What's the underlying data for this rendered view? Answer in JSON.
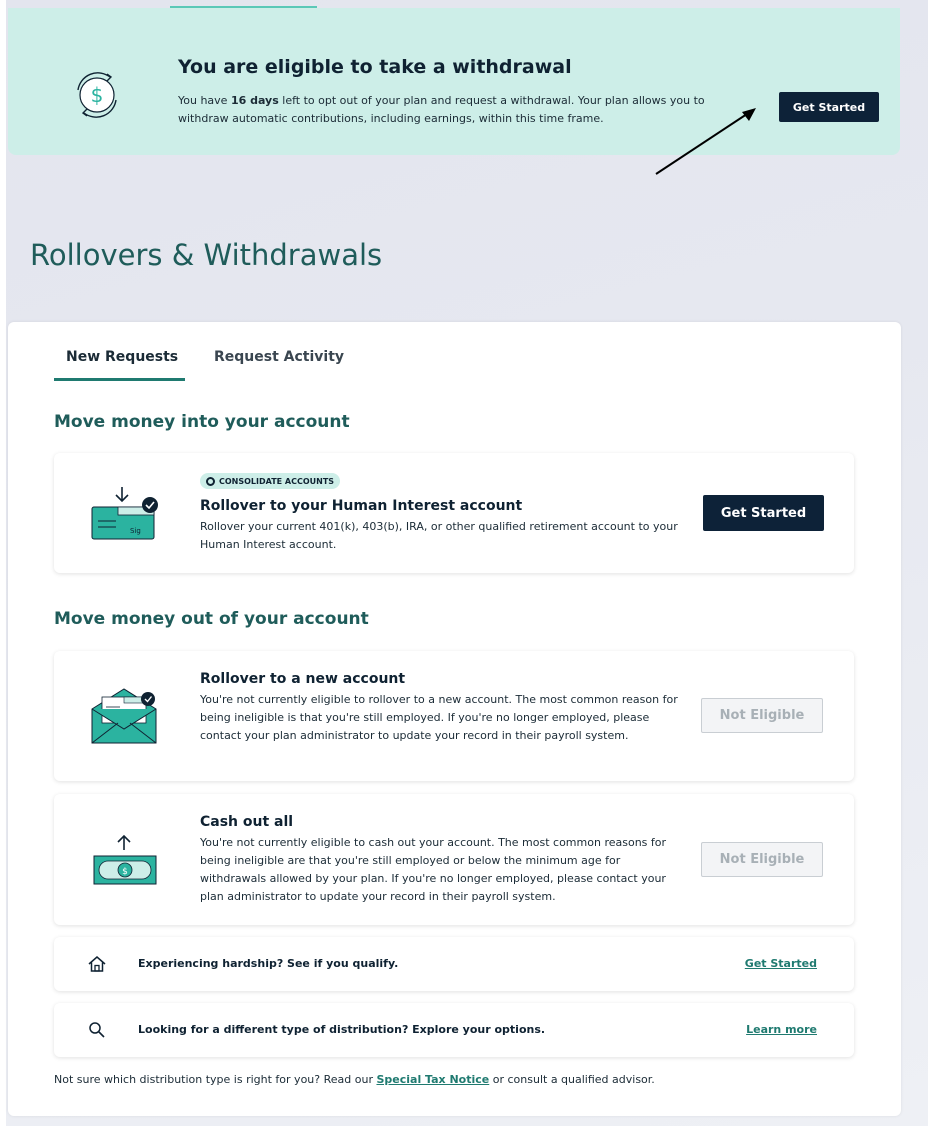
{
  "banner": {
    "title": "You are eligible to take a withdrawal",
    "text_before": "You have ",
    "days": "16 days",
    "text_after": " left to opt out of your plan and request a withdrawal. Your plan allows you to withdraw automatic contributions, including earnings, within this time frame.",
    "button": "Get Started"
  },
  "page_title": "Rollovers & Withdrawals",
  "tabs": [
    {
      "label": "New Requests",
      "active": true
    },
    {
      "label": "Request Activity",
      "active": false
    }
  ],
  "section_in": {
    "heading": "Move money into your account",
    "card": {
      "badge": "CONSOLIDATE ACCOUNTS",
      "title": "Rollover to your Human Interest account",
      "desc": "Rollover your current 401(k), 403(b), IRA, or other qualified retirement account to your Human Interest account.",
      "button": "Get Started"
    }
  },
  "section_out": {
    "heading": "Move money out of your account",
    "cards": [
      {
        "title": "Rollover to a new account",
        "desc": "You're not currently eligible to rollover to a new account. The most common reason for being ineligible is that you're still employed. If you're no longer employed, please contact your plan administrator to update your record in their payroll system.",
        "button": "Not Eligible"
      },
      {
        "title": "Cash out all",
        "desc": "You're not currently eligible to cash out your account. The most common reasons for being ineligible are that you're still employed or below the minimum age for withdrawals allowed by your plan. If you're no longer employed, please contact your plan administrator to update your record in their payroll system.",
        "button": "Not Eligible"
      }
    ]
  },
  "links": [
    {
      "icon": "home-icon",
      "text": "Experiencing hardship? See if you qualify.",
      "action": "Get Started"
    },
    {
      "icon": "search-icon",
      "text": "Looking for a different type of distribution? Explore your options.",
      "action": "Learn more"
    }
  ],
  "footer": {
    "before": "Not sure which distribution type is right for you? Read our ",
    "link": "Special Tax Notice",
    "after": " or consult a qualified advisor."
  },
  "colors": {
    "banner_bg": "#cdeee8",
    "teal_heading": "#1f5c5a",
    "teal_link": "#1f7a70",
    "navy_button": "#0d2238",
    "icon_teal": "#2bb3a0"
  }
}
